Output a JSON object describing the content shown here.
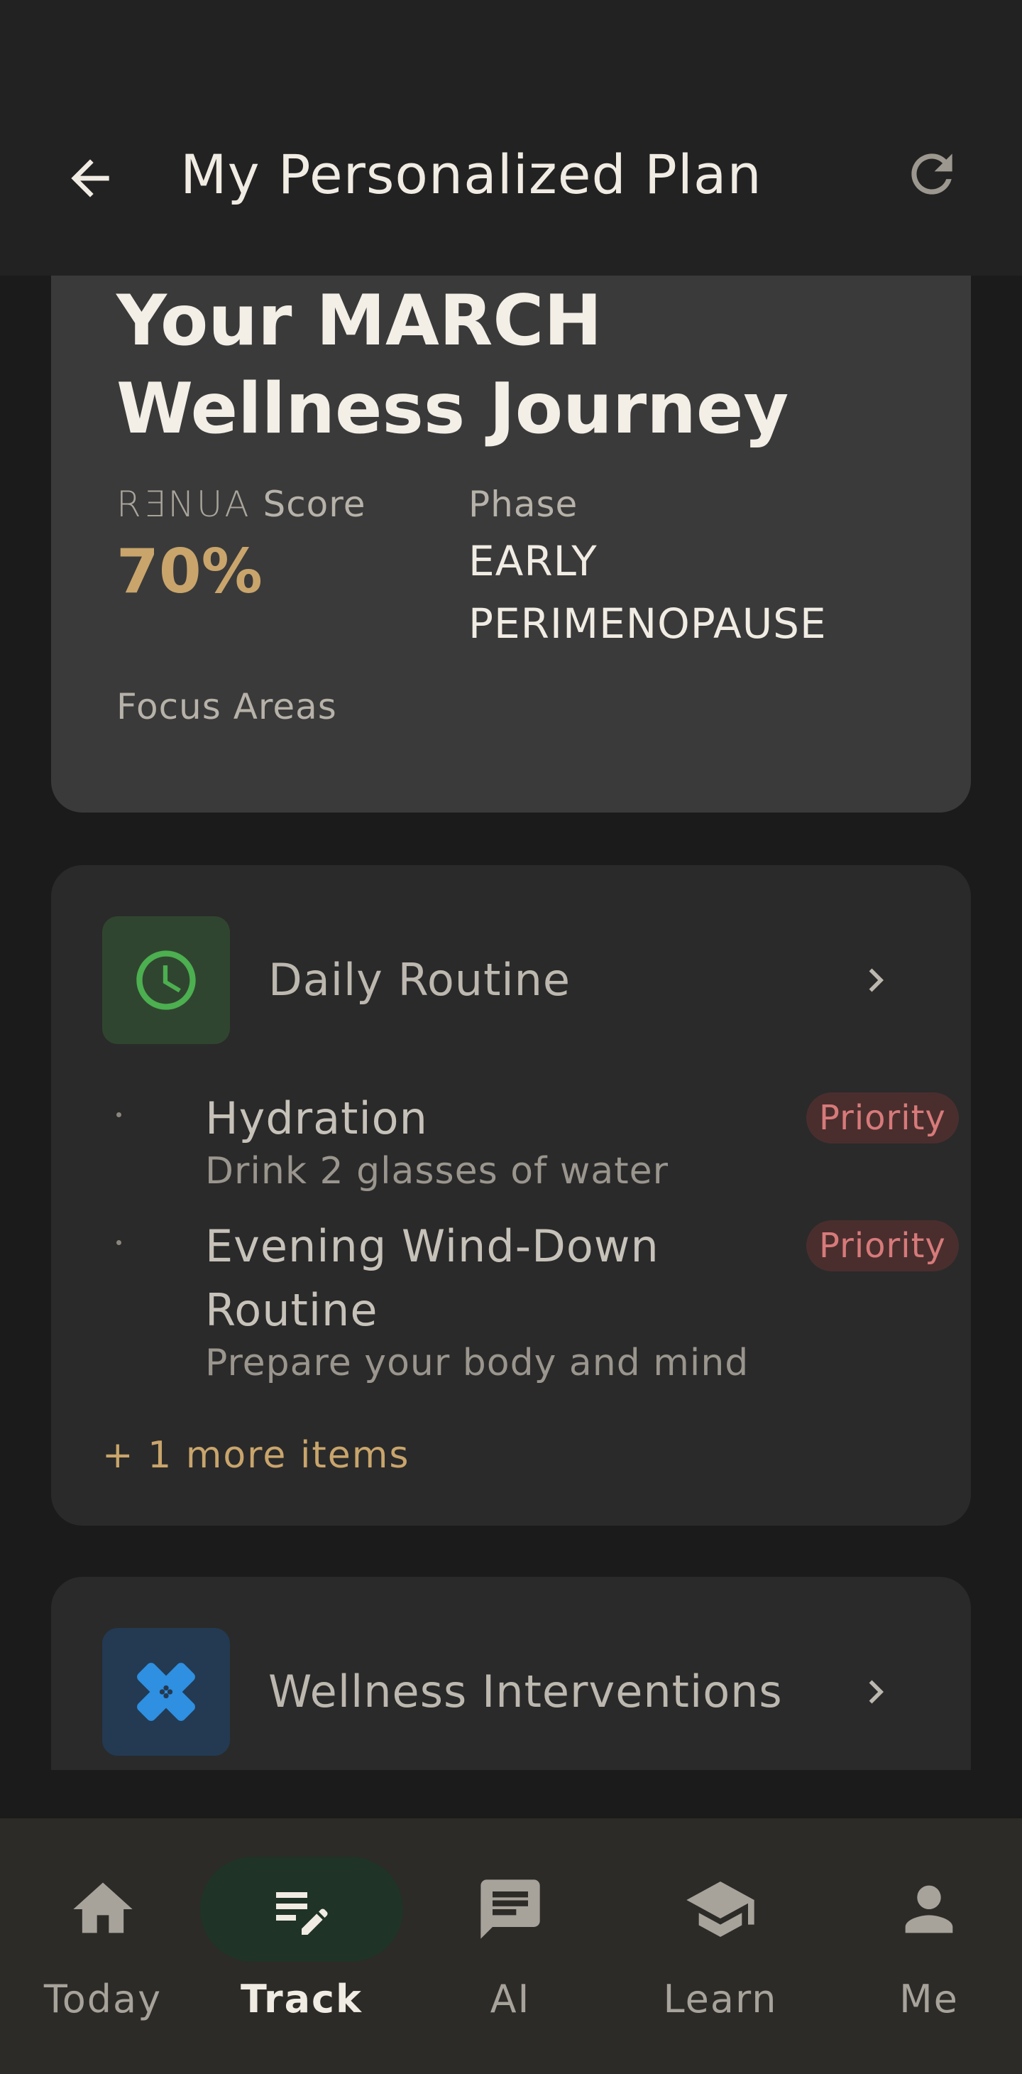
{
  "header": {
    "title": "My Personalized Plan",
    "back_icon": "arrow-left-icon",
    "refresh_icon": "refresh-icon"
  },
  "summary": {
    "title_line1": "Your MARCH",
    "title_line2": "Wellness Journey",
    "score_brand": "RƎNUA",
    "score_label": "Score",
    "score_value": "70%",
    "phase_label": "Phase",
    "phase_line1": "EARLY",
    "phase_line2": "PERIMENOPAUSE",
    "focus_label": "Focus Areas"
  },
  "daily_routine": {
    "title": "Daily Routine",
    "icon": "clock-icon",
    "items": [
      {
        "title": "Hydration",
        "subtitle": "Drink 2 glasses of water",
        "badge": "Priority"
      },
      {
        "title_line1": "Evening Wind-Down",
        "title_line2": "Routine",
        "subtitle": "Prepare your body and mind",
        "badge": "Priority"
      }
    ],
    "more": "+ 1 more items"
  },
  "wellness_interventions": {
    "title": "Wellness Interventions",
    "icon": "bandage-icon"
  },
  "nav": {
    "items": [
      {
        "label": "Today",
        "icon": "home-icon"
      },
      {
        "label": "Track",
        "icon": "edit-notes-icon"
      },
      {
        "label": "AI",
        "icon": "chat-icon"
      },
      {
        "label": "Learn",
        "icon": "graduation-cap-icon"
      },
      {
        "label": "Me",
        "icon": "person-icon"
      }
    ],
    "active": "Track"
  },
  "colors": {
    "accent_gold": "#c9a56c",
    "priority_text": "#d77a7a",
    "active_nav_bg": "#1f3326",
    "routine_icon_green": "#4caf50",
    "interventions_icon_blue": "#2f8fe0"
  }
}
